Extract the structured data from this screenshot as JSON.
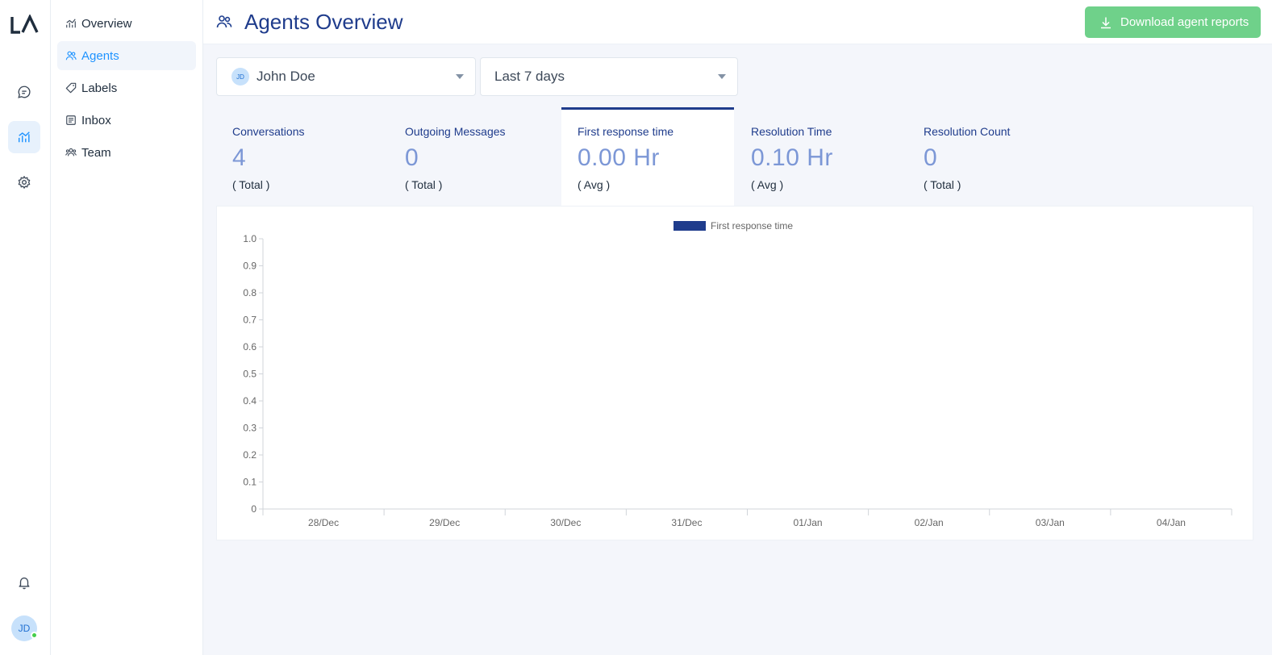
{
  "brand": {
    "logo_text": "LA"
  },
  "rail": {
    "items": [
      {
        "name": "conversations",
        "icon": "chat-bubble-icon"
      },
      {
        "name": "reports",
        "icon": "chart-icon",
        "active": true
      },
      {
        "name": "settings",
        "icon": "gear-icon"
      }
    ],
    "bottom": {
      "notifications_icon": "bell-icon",
      "avatar_initials": "JD",
      "status": "online"
    }
  },
  "sidebar": {
    "items": [
      {
        "label": "Overview",
        "icon": "chart-icon"
      },
      {
        "label": "Agents",
        "icon": "users-icon",
        "active": true
      },
      {
        "label": "Labels",
        "icon": "tag-icon"
      },
      {
        "label": "Inbox",
        "icon": "inbox-icon"
      },
      {
        "label": "Team",
        "icon": "team-icon"
      }
    ]
  },
  "header": {
    "title": "Agents Overview",
    "download_label": "Download agent reports"
  },
  "filters": {
    "agent": {
      "value": "John Doe",
      "avatar_initials": "JD"
    },
    "range": {
      "value": "Last 7 days"
    }
  },
  "metrics": [
    {
      "title": "Conversations",
      "value": "4",
      "sub": "( Total )"
    },
    {
      "title": "Outgoing Messages",
      "value": "0",
      "sub": "( Total )"
    },
    {
      "title": "First response time",
      "value": "0.00 Hr",
      "sub": "( Avg )",
      "active": true
    },
    {
      "title": "Resolution Time",
      "value": "0.10 Hr",
      "sub": "( Avg )"
    },
    {
      "title": "Resolution Count",
      "value": "0",
      "sub": "( Total )"
    }
  ],
  "colors": {
    "accent": "#1f93ff",
    "title": "#1f3c8c",
    "series": "#1f3c8c",
    "download": "#6fd18a"
  },
  "chart_data": {
    "type": "bar",
    "legend": [
      "First response time"
    ],
    "legend_position": "top-center",
    "categories": [
      "28/Dec",
      "29/Dec",
      "30/Dec",
      "31/Dec",
      "01/Jan",
      "02/Jan",
      "03/Jan",
      "04/Jan"
    ],
    "series": [
      {
        "name": "First response time",
        "values": [
          0,
          0,
          0,
          0,
          0,
          0,
          0,
          0
        ]
      }
    ],
    "yticks": [
      "0",
      "0.1",
      "0.2",
      "0.3",
      "0.4",
      "0.5",
      "0.6",
      "0.7",
      "0.8",
      "0.9",
      "1.0"
    ],
    "ylim": [
      0,
      1.0
    ],
    "grid": false
  }
}
